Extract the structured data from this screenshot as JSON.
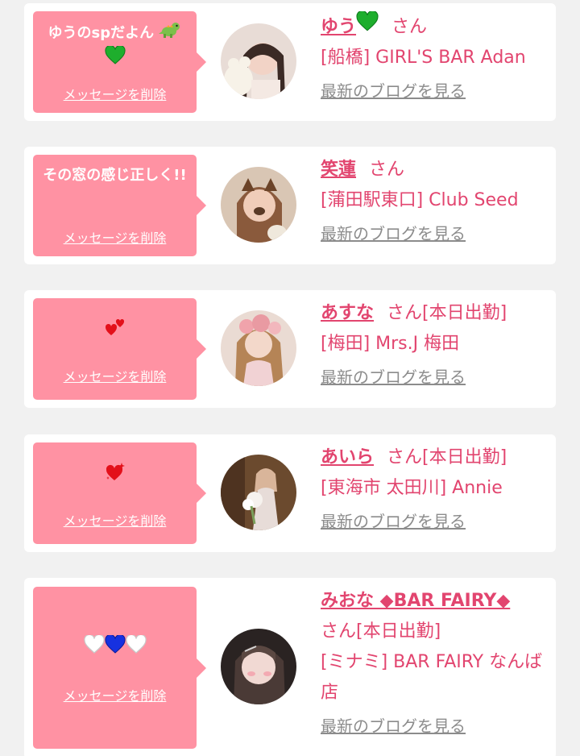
{
  "common": {
    "delete_label": "メッセージを削除",
    "blog_label": "最新のブログを見る",
    "honorific": "さん"
  },
  "items": [
    {
      "bubble_text": "ゆうのspだよん",
      "bubble_icons": [
        "dino-icon",
        "green-heart-icon"
      ],
      "name": "ゆう",
      "name_icon": "green-heart-icon",
      "status": "",
      "shop": "[船橋] GIRL'S BAR Adan"
    },
    {
      "bubble_text": "その窓の感じ正しく!!",
      "bubble_icons": [],
      "name": "笑蓮",
      "status": "",
      "shop": "[蒲田駅東口] Club Seed"
    },
    {
      "bubble_text": "",
      "bubble_icons": [
        "two-red-hearts-icon"
      ],
      "name": "あすな",
      "status": "[本日出勤]",
      "shop": "[梅田] Mrs.J 梅田"
    },
    {
      "bubble_text": "",
      "bubble_icons": [
        "sparkling-heart-icon"
      ],
      "name": "あいら",
      "status": "[本日出勤]",
      "shop": "[東海市 太田川] Annie"
    },
    {
      "bubble_text": "",
      "bubble_icons": [
        "white-heart-icon",
        "blue-heart-icon",
        "white-heart-icon"
      ],
      "name": "みおな ◆BAR FAIRY◆",
      "status": "[本日出勤]",
      "shop": "[ミナミ] BAR FAIRY なんば店"
    }
  ],
  "colors": {
    "accent": "#e2456f",
    "bubble": "#ff92a3",
    "page_bg": "#f1f1f1",
    "card_bg": "#ffffff",
    "link_gray": "#8c8c8c"
  }
}
